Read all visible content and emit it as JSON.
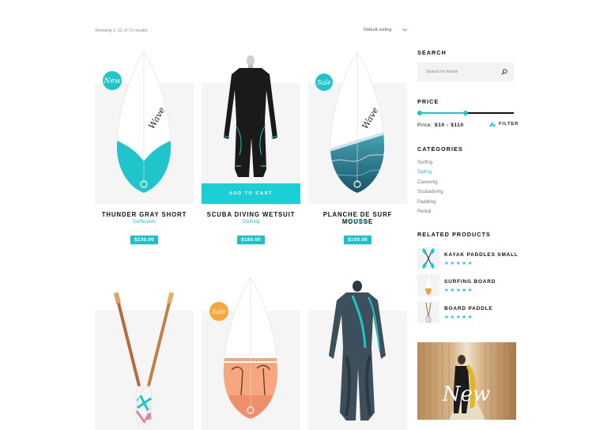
{
  "toolbar": {
    "results_text": "Showing 1–12 of 72 results",
    "sort_selected": "Default sorting",
    "sort_icon": "chevron-down-icon"
  },
  "products": [
    {
      "title": "THUNDER GRAY SHORT",
      "category": "Surfboards",
      "price": "$130.00",
      "badge": "New",
      "image": "surfboard-teal-icon"
    },
    {
      "title": "SCUBA DIVING WETSUIT",
      "category": "Clothing",
      "price": "$180.00",
      "hover_button": "ADD TO CART",
      "image": "wetsuit-black-icon"
    },
    {
      "title": "PLANCHE DE SURF MOUSSE",
      "category": "Surfboards",
      "price": "$100.00",
      "badge": "Sale",
      "image": "surfboard-wave-icon"
    },
    {
      "image": "paddles-crossed-icon"
    },
    {
      "badge": "Sale",
      "image": "surfboard-sunset-icon"
    },
    {
      "image": "wetsuit-gray-icon"
    }
  ],
  "sidebar": {
    "search": {
      "title": "SEARCH",
      "placeholder": "Search for Article",
      "icon": "search-icon"
    },
    "price": {
      "title": "PRICE",
      "label": "Price:",
      "range": "$10 - $110",
      "filter_label": "FILTER",
      "min_fraction": 0.0,
      "max_fraction": 0.5
    },
    "categories": {
      "title": "CATEGORIES",
      "items": [
        "Surfing",
        "Sailing",
        "Canoenig",
        "Scubadiving",
        "Paddling",
        "Rental"
      ],
      "active": "Sailing"
    },
    "related": {
      "title": "RELATED PRODUCTS",
      "items": [
        {
          "name": "KAYAK PADDLES SMALL",
          "rating": 5,
          "stars": "★★★★★"
        },
        {
          "name": "SURFING BOARD",
          "rating": 5,
          "stars": "★★★★★"
        },
        {
          "name": "BOARD PADDLE",
          "rating": 5,
          "stars": "★★★★★"
        }
      ]
    },
    "promo": {
      "badge": "New"
    }
  },
  "colors": {
    "accent": "#1fc5cb",
    "button": "#1ccfd5",
    "dark": "#111111"
  }
}
